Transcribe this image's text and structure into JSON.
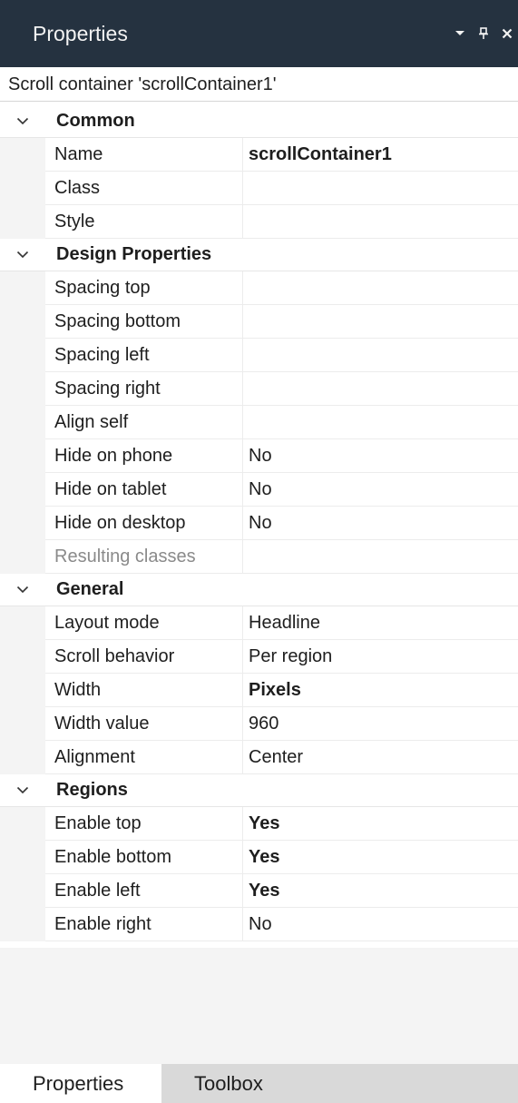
{
  "window": {
    "title": "Properties",
    "dropdown_icon": "dropdown-arrow-icon",
    "pin_icon": "pin-icon",
    "close_icon": "close-icon"
  },
  "selection_label": "Scroll container 'scrollContainer1'",
  "groups": [
    {
      "name": "Common",
      "rows": [
        {
          "label": "Name",
          "value": "scrollContainer1",
          "bold": true
        },
        {
          "label": "Class",
          "value": ""
        },
        {
          "label": "Style",
          "value": ""
        }
      ]
    },
    {
      "name": "Design Properties",
      "rows": [
        {
          "label": "Spacing top",
          "value": ""
        },
        {
          "label": "Spacing bottom",
          "value": ""
        },
        {
          "label": "Spacing left",
          "value": ""
        },
        {
          "label": "Spacing right",
          "value": ""
        },
        {
          "label": "Align self",
          "value": ""
        },
        {
          "label": "Hide on phone",
          "value": "No"
        },
        {
          "label": "Hide on tablet",
          "value": "No"
        },
        {
          "label": "Hide on desktop",
          "value": "No"
        },
        {
          "label": "Resulting classes",
          "value": "",
          "disabled": true
        }
      ]
    },
    {
      "name": "General",
      "rows": [
        {
          "label": "Layout mode",
          "value": "Headline"
        },
        {
          "label": "Scroll behavior",
          "value": "Per region"
        },
        {
          "label": "Width",
          "value": "Pixels",
          "bold": true
        },
        {
          "label": "Width value",
          "value": "960"
        },
        {
          "label": "Alignment",
          "value": "Center"
        }
      ]
    },
    {
      "name": "Regions",
      "rows": [
        {
          "label": "Enable top",
          "value": "Yes",
          "bold": true
        },
        {
          "label": "Enable bottom",
          "value": "Yes",
          "bold": true
        },
        {
          "label": "Enable left",
          "value": "Yes",
          "bold": true
        },
        {
          "label": "Enable right",
          "value": "No"
        }
      ]
    }
  ],
  "tabs": [
    {
      "label": "Properties",
      "active": true
    },
    {
      "label": "Toolbox",
      "active": false
    }
  ],
  "colors": {
    "titlebar_bg": "#253240",
    "gutter_bg": "#f4f4f4",
    "tab_strip_bg": "#d9d9d9"
  }
}
